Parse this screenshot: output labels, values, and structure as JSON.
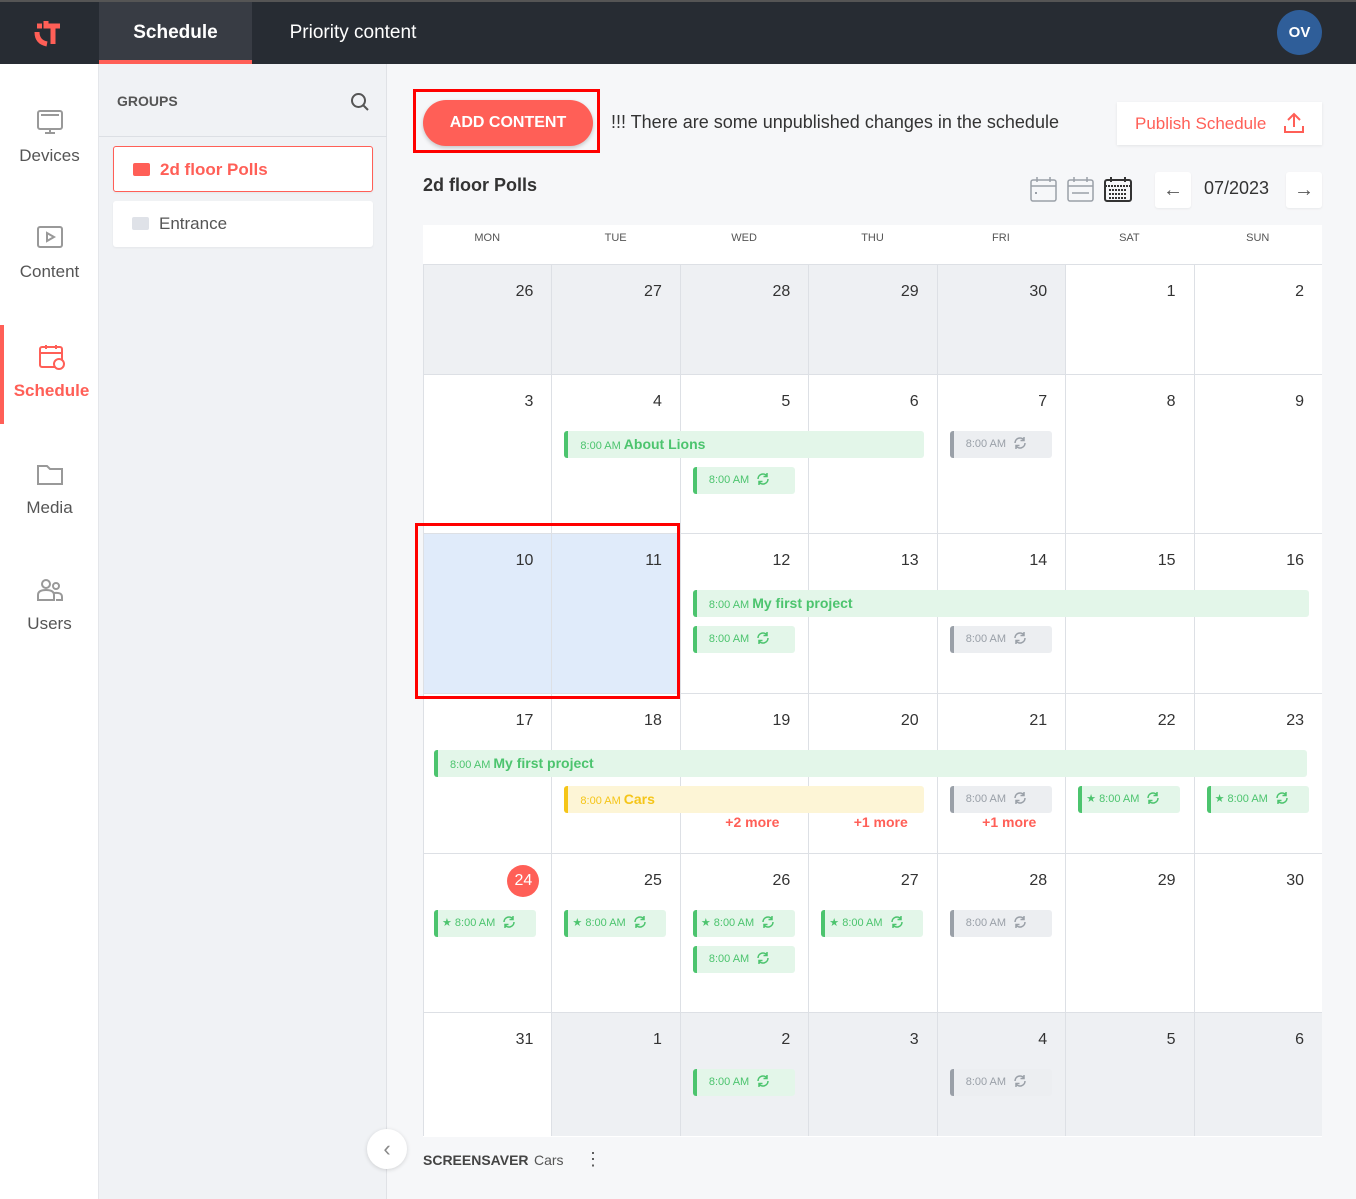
{
  "topbar": {
    "tabs": [
      {
        "label": "Schedule"
      },
      {
        "label": "Priority content"
      }
    ],
    "avatar": "OV"
  },
  "nav": [
    {
      "label": "Devices"
    },
    {
      "label": "Content"
    },
    {
      "label": "Schedule"
    },
    {
      "label": "Media"
    },
    {
      "label": "Users"
    }
  ],
  "groups": {
    "heading": "GROUPS",
    "items": [
      {
        "label": "2d floor Polls"
      },
      {
        "label": "Entrance"
      }
    ]
  },
  "toolbar": {
    "add_label": "ADD CONTENT",
    "warning": "!!! There are some unpublished changes in the schedule",
    "publish_label": "Publish Schedule"
  },
  "calendar": {
    "title": "2d floor Polls",
    "month": "07/2023",
    "days_of_week": [
      "MON",
      "TUE",
      "WED",
      "THU",
      "FRI",
      "SAT",
      "SUN"
    ],
    "weeks": [
      [
        "26",
        "27",
        "28",
        "29",
        "30",
        "1",
        "2"
      ],
      [
        "3",
        "4",
        "5",
        "6",
        "7",
        "8",
        "9"
      ],
      [
        "10",
        "11",
        "12",
        "13",
        "14",
        "15",
        "16"
      ],
      [
        "17",
        "18",
        "19",
        "20",
        "21",
        "22",
        "23"
      ],
      [
        "24",
        "25",
        "26",
        "27",
        "28",
        "29",
        "30"
      ],
      [
        "31",
        "1",
        "2",
        "3",
        "4",
        "5",
        "6"
      ]
    ],
    "out_of_month": [
      [
        1,
        1,
        1,
        1,
        1,
        0,
        0
      ],
      [
        0,
        0,
        0,
        0,
        0,
        0,
        0
      ],
      [
        0,
        0,
        0,
        0,
        0,
        0,
        0
      ],
      [
        0,
        0,
        0,
        0,
        0,
        0,
        0
      ],
      [
        0,
        0,
        0,
        0,
        0,
        0,
        0
      ],
      [
        0,
        1,
        1,
        1,
        1,
        1,
        1
      ]
    ],
    "today": {
      "week": 4,
      "day": 0
    },
    "selected": [
      {
        "week": 2,
        "day": 0
      },
      {
        "week": 2,
        "day": 1
      }
    ],
    "events": [
      {
        "week": 1,
        "day": 1,
        "span": 3,
        "slot": 0,
        "time": "8:00 AM",
        "title": "About Lions",
        "color": "green"
      },
      {
        "week": 1,
        "day": 2,
        "span": 1,
        "slot": 1,
        "time": "8:00 AM",
        "color": "green",
        "repeat": true
      },
      {
        "week": 1,
        "day": 4,
        "span": 1,
        "slot": 0,
        "time": "8:00 AM",
        "color": "gray",
        "repeat": true
      },
      {
        "week": 2,
        "day": 2,
        "span": 5,
        "slot": 0,
        "time": "8:00 AM",
        "title": "My first project",
        "color": "green"
      },
      {
        "week": 2,
        "day": 2,
        "span": 1,
        "slot": 1,
        "time": "8:00 AM",
        "color": "green",
        "repeat": true
      },
      {
        "week": 2,
        "day": 4,
        "span": 1,
        "slot": 1,
        "time": "8:00 AM",
        "color": "gray",
        "repeat": true
      },
      {
        "week": 3,
        "day": 0,
        "span": 7,
        "slot": 0,
        "time": "8:00 AM",
        "title": "My first project",
        "color": "green"
      },
      {
        "week": 3,
        "day": 1,
        "span": 3,
        "slot": 1,
        "time": "8:00 AM",
        "title": "Cars",
        "color": "yellow"
      },
      {
        "week": 3,
        "day": 4,
        "span": 1,
        "slot": 1,
        "time": "8:00 AM",
        "color": "gray",
        "repeat": true
      },
      {
        "week": 3,
        "day": 5,
        "span": 1,
        "slot": 1,
        "time": "8:00 AM",
        "color": "green",
        "repeat": true,
        "priority": true
      },
      {
        "week": 3,
        "day": 6,
        "span": 1,
        "slot": 1,
        "time": "8:00 AM",
        "color": "green",
        "repeat": true,
        "priority": true
      },
      {
        "week": 4,
        "day": 0,
        "span": 1,
        "slot": 0,
        "time": "8:00 AM",
        "color": "green",
        "repeat": true,
        "priority": true
      },
      {
        "week": 4,
        "day": 1,
        "span": 1,
        "slot": 0,
        "time": "8:00 AM",
        "color": "green",
        "repeat": true,
        "priority": true
      },
      {
        "week": 4,
        "day": 2,
        "span": 1,
        "slot": 0,
        "time": "8:00 AM",
        "color": "green",
        "repeat": true,
        "priority": true
      },
      {
        "week": 4,
        "day": 2,
        "span": 1,
        "slot": 1,
        "time": "8:00 AM",
        "color": "green",
        "repeat": true
      },
      {
        "week": 4,
        "day": 3,
        "span": 1,
        "slot": 0,
        "time": "8:00 AM",
        "color": "green",
        "repeat": true,
        "priority": true
      },
      {
        "week": 4,
        "day": 4,
        "span": 1,
        "slot": 0,
        "time": "8:00 AM",
        "color": "gray",
        "repeat": true
      },
      {
        "week": 5,
        "day": 2,
        "span": 1,
        "slot": 0,
        "time": "8:00 AM",
        "color": "green",
        "repeat": true
      },
      {
        "week": 5,
        "day": 4,
        "span": 1,
        "slot": 0,
        "time": "8:00 AM",
        "color": "gray",
        "repeat": true
      }
    ],
    "more": [
      {
        "week": 3,
        "day": 2,
        "label": "+2 more"
      },
      {
        "week": 3,
        "day": 3,
        "label": "+1 more"
      },
      {
        "week": 3,
        "day": 4,
        "label": "+1 more"
      }
    ]
  },
  "footer": {
    "label": "SCREENSAVER",
    "value": "Cars",
    "menu": "⋮"
  }
}
